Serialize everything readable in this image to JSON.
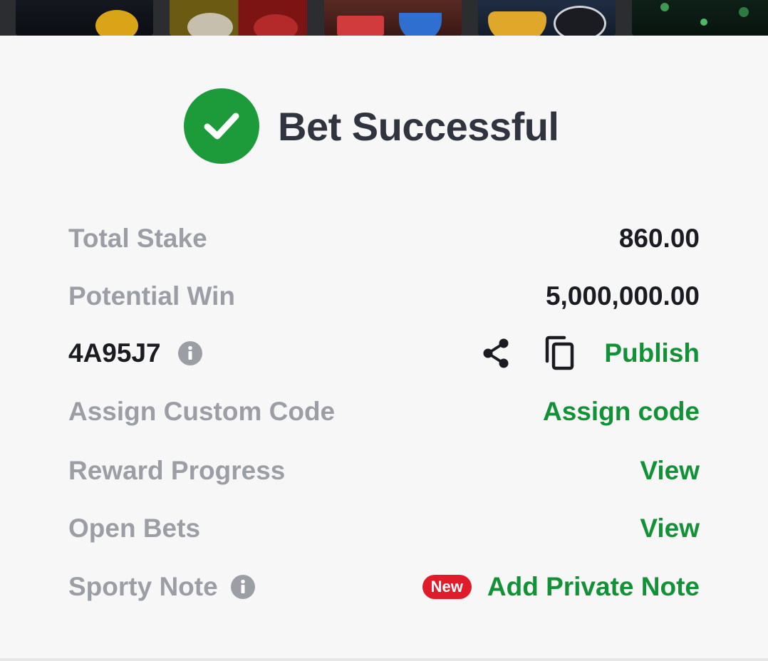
{
  "header": {
    "title": "Bet Successful"
  },
  "summary": {
    "total_stake_label": "Total Stake",
    "total_stake_value": "860.00",
    "potential_win_label": "Potential Win",
    "potential_win_value": "5,000,000.00",
    "booking_code": "4A95J7",
    "publish_label": "Publish",
    "assign_custom_code_label": "Assign Custom Code",
    "assign_code_link": "Assign code",
    "reward_progress_label": "Reward Progress",
    "reward_progress_link": "View",
    "open_bets_label": "Open Bets",
    "open_bets_link": "View",
    "sporty_note_label": "Sporty Note",
    "new_badge": "New",
    "add_private_note_link": "Add Private Note"
  },
  "icons": {
    "success": "check-circle-icon",
    "info": "info-icon",
    "share": "share-icon",
    "copy": "copy-icon"
  },
  "colors": {
    "success_green": "#1d9b3a",
    "link_green": "#139137",
    "badge_red": "#e01c2b",
    "muted_label": "#9c9ea6",
    "dark_text": "#1a1c22"
  }
}
